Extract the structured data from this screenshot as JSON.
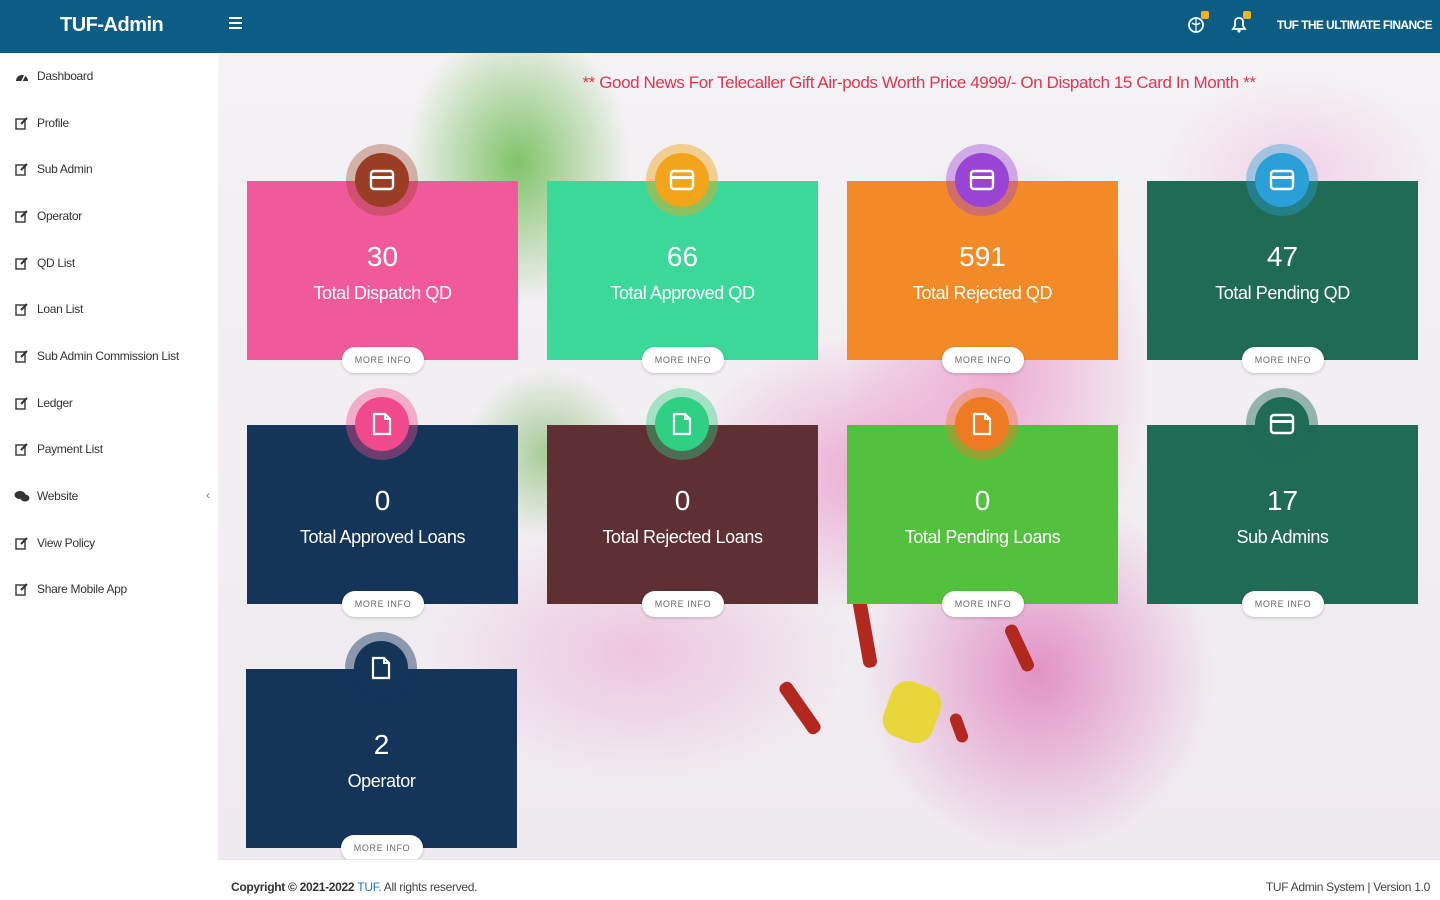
{
  "header": {
    "brand": "TUF-Admin",
    "company": "TUF THE ULTIMATE FINANCE",
    "icons": [
      "globe-icon",
      "bell-icon"
    ]
  },
  "sidebar": {
    "items": [
      {
        "label": "Dashboard",
        "icon": "dashboard-icon"
      },
      {
        "label": "Profile",
        "icon": "edit-icon"
      },
      {
        "label": "Sub Admin",
        "icon": "edit-icon"
      },
      {
        "label": "Operator",
        "icon": "edit-icon"
      },
      {
        "label": "QD List",
        "icon": "edit-icon"
      },
      {
        "label": "Loan List",
        "icon": "edit-icon"
      },
      {
        "label": "Sub Admin Commission List",
        "icon": "edit-icon"
      },
      {
        "label": "Ledger",
        "icon": "edit-icon"
      },
      {
        "label": "Payment List",
        "icon": "edit-icon"
      },
      {
        "label": "Website",
        "icon": "chat-icon"
      },
      {
        "label": "View Policy",
        "icon": "edit-icon"
      },
      {
        "label": "Share Mobile App",
        "icon": "edit-icon"
      }
    ]
  },
  "news": "** Good News For Telecaller Gift Air-pods Worth Price 4999/- On Dispatch 15 Card In Month **",
  "cards": [
    {
      "value": "30",
      "label": "Total Dispatch QD",
      "more": "MORE INFO",
      "icon": "card-icon",
      "color": "#f15a9a",
      "badge": "#9a3d25"
    },
    {
      "value": "66",
      "label": "Total Approved QD",
      "more": "MORE INFO",
      "icon": "card-icon",
      "color": "#3bd89a",
      "badge": "#f2a51a"
    },
    {
      "value": "591",
      "label": "Total Rejected QD",
      "more": "MORE INFO",
      "icon": "card-icon",
      "color": "#f28a27",
      "badge": "#9a44d6"
    },
    {
      "value": "47",
      "label": "Total Pending QD",
      "more": "MORE INFO",
      "icon": "card-icon",
      "color": "#1f6b56",
      "badge": "#2a9fd8"
    },
    {
      "value": "0",
      "label": "Total Approved Loans",
      "more": "MORE INFO",
      "icon": "document-icon",
      "color": "#14345a",
      "badge": "#f14a8c"
    },
    {
      "value": "0",
      "label": "Total Rejected Loans",
      "more": "MORE INFO",
      "icon": "document-icon",
      "color": "#5e2f33",
      "badge": "#2fcf84"
    },
    {
      "value": "0",
      "label": "Total Pending Loans",
      "more": "MORE INFO",
      "icon": "document-icon",
      "color": "#53c13e",
      "badge": "#ef7a24"
    },
    {
      "value": "17",
      "label": "Sub Admins",
      "more": "MORE INFO",
      "icon": "card-icon",
      "color": "#1f6b56",
      "badge": "#1f6b56"
    },
    {
      "value": "2",
      "label": "Operator",
      "more": "MORE INFO",
      "icon": "document-icon",
      "color": "#14345a",
      "badge": "#14345a"
    }
  ],
  "footer": {
    "copyright_prefix": "Copyright © 2021-2022 ",
    "copyright_brand": "TUF.",
    "copyright_suffix": " All rights reserved.",
    "version": "TUF Admin System | Version 1.0"
  }
}
